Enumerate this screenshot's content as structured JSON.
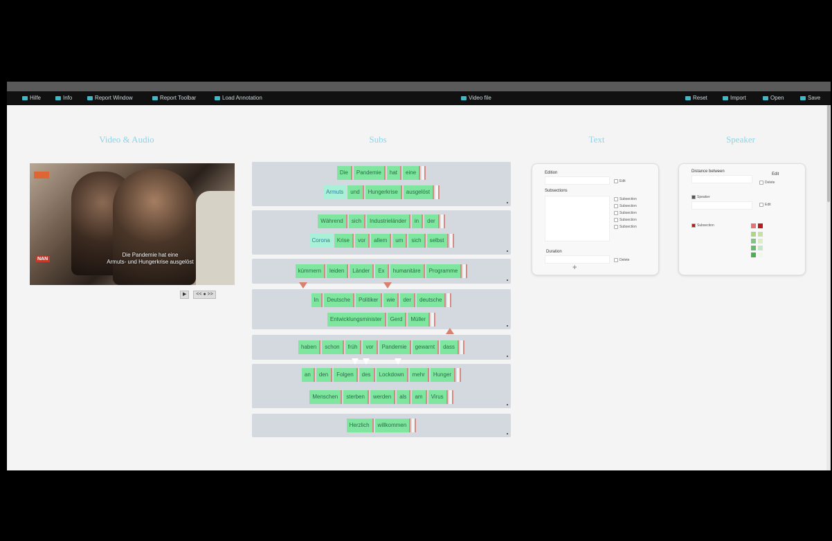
{
  "navbar": {
    "left": [
      "Hilfe",
      "Info",
      "Report Window",
      "Report Toolbar",
      "Load Annotation"
    ],
    "center": "Video file",
    "right": [
      "Reset",
      "Import",
      "Open",
      "Save"
    ]
  },
  "sections": {
    "video_title": "Video & Audio",
    "subtitle_title": "Subs",
    "text_title": "Text",
    "speaker_title": "Speaker"
  },
  "video": {
    "subtitle_lines": [
      "Die Pandemie hat eine",
      "Armuts- und Hungerkrise ausgelöst"
    ],
    "logo": "NAN"
  },
  "player": {
    "play": "▶",
    "speed": "<< ● >>"
  },
  "subtitle_blocks": [
    {
      "lines": [
        {
          "speaker": "",
          "words": [
            "Die",
            "Pandemie",
            "hat",
            "eine"
          ]
        },
        {
          "speaker": "Armuts",
          "words": [
            "und",
            "Hungerkrise",
            "ausgelöst"
          ]
        }
      ]
    },
    {
      "lines": [
        {
          "speaker": "",
          "words": [
            "Während",
            "sich",
            "Industrieländer",
            "in",
            "der"
          ]
        },
        {
          "speaker": "Corona",
          "words": [
            "Krise",
            "vor",
            "allem",
            "um",
            "sich",
            "selbst"
          ]
        }
      ]
    },
    {
      "lines": [
        {
          "speaker": "",
          "words": [
            "kümmern",
            "leiden",
            "Länder",
            "Ex",
            "humanitäre",
            "Programme"
          ]
        }
      ]
    },
    {
      "lines": [
        {
          "speaker": "",
          "words": [
            "In",
            "Deutsche",
            "Politiker",
            "wie",
            "der",
            "deutsche"
          ]
        },
        {
          "speaker": "",
          "words": [
            "Entwicklungsminister",
            "Gerd",
            "Müller"
          ]
        }
      ]
    },
    {
      "lines": [
        {
          "speaker": "",
          "words": [
            "haben",
            "schon",
            "früh",
            "vor",
            "Pandemie",
            "gewarnt",
            "dass"
          ]
        }
      ]
    },
    {
      "lines": [
        {
          "speaker": "",
          "words": [
            "an",
            "den",
            "Folgen",
            "des",
            "Lockdown",
            "mehr",
            "Hunger"
          ]
        },
        {
          "speaker": "",
          "words": [
            "Menschen",
            "sterben",
            "werden",
            "als",
            "am",
            "Virus"
          ]
        }
      ]
    },
    {
      "lines": [
        {
          "speaker": "",
          "words": [
            "Herzlich",
            "willkommen"
          ]
        }
      ]
    }
  ],
  "text_panel": {
    "field1_label": "Edition",
    "field1_option": "Edit",
    "field2_label": "Subsections",
    "options": [
      "Subsection",
      "Subsection",
      "Subsection",
      "Subsection",
      "Subsection"
    ],
    "field3_label": "Duration",
    "field3_option": "Delete",
    "plus": "+"
  },
  "speaker_panel": {
    "label1": "Distance between",
    "opt1a": "Edit",
    "opt1b": "Delete",
    "label2": "Speaker",
    "opt2": "Edit",
    "label3": "Subsection",
    "colors": [
      "#e57373",
      "#b71c1c",
      "#aed581",
      "#c5e1a5",
      "#81c784",
      "#dcedc8",
      "#66bb6a",
      "#c8e6c9",
      "#4caf50",
      "#f1f8e9"
    ]
  }
}
